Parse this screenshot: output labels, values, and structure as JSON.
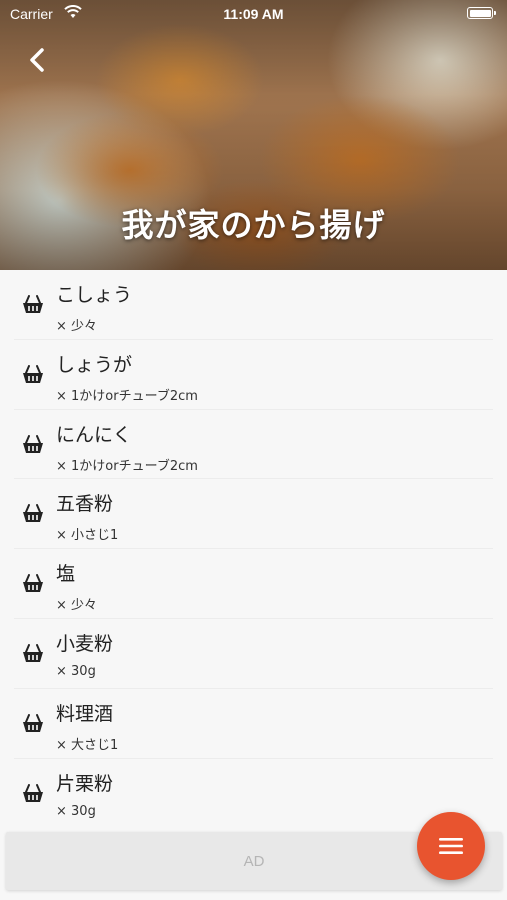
{
  "status_bar": {
    "carrier": "Carrier",
    "time": "11:09 AM"
  },
  "hero": {
    "title": "我が家のから揚げ"
  },
  "ingredients": [
    {
      "name": "こしょう",
      "quantity": "× 少々"
    },
    {
      "name": "しょうが",
      "quantity": "× 1かけorチューブ2cm"
    },
    {
      "name": "にんにく",
      "quantity": "× 1かけorチューブ2cm"
    },
    {
      "name": "五香粉",
      "quantity": "× 小さじ1"
    },
    {
      "name": "塩",
      "quantity": "× 少々"
    },
    {
      "name": "小麦粉",
      "quantity": "× 30g"
    },
    {
      "name": "料理酒",
      "quantity": "× 大さじ1"
    },
    {
      "name": "片栗粉",
      "quantity": "× 30g"
    }
  ],
  "ad": {
    "label": "AD"
  },
  "colors": {
    "accent": "#e8542f",
    "text": "#222222",
    "background": "#f7f7f7"
  },
  "icons": {
    "back": "chevron-left-icon",
    "ingredient": "basket-icon",
    "menu": "menu-icon"
  }
}
